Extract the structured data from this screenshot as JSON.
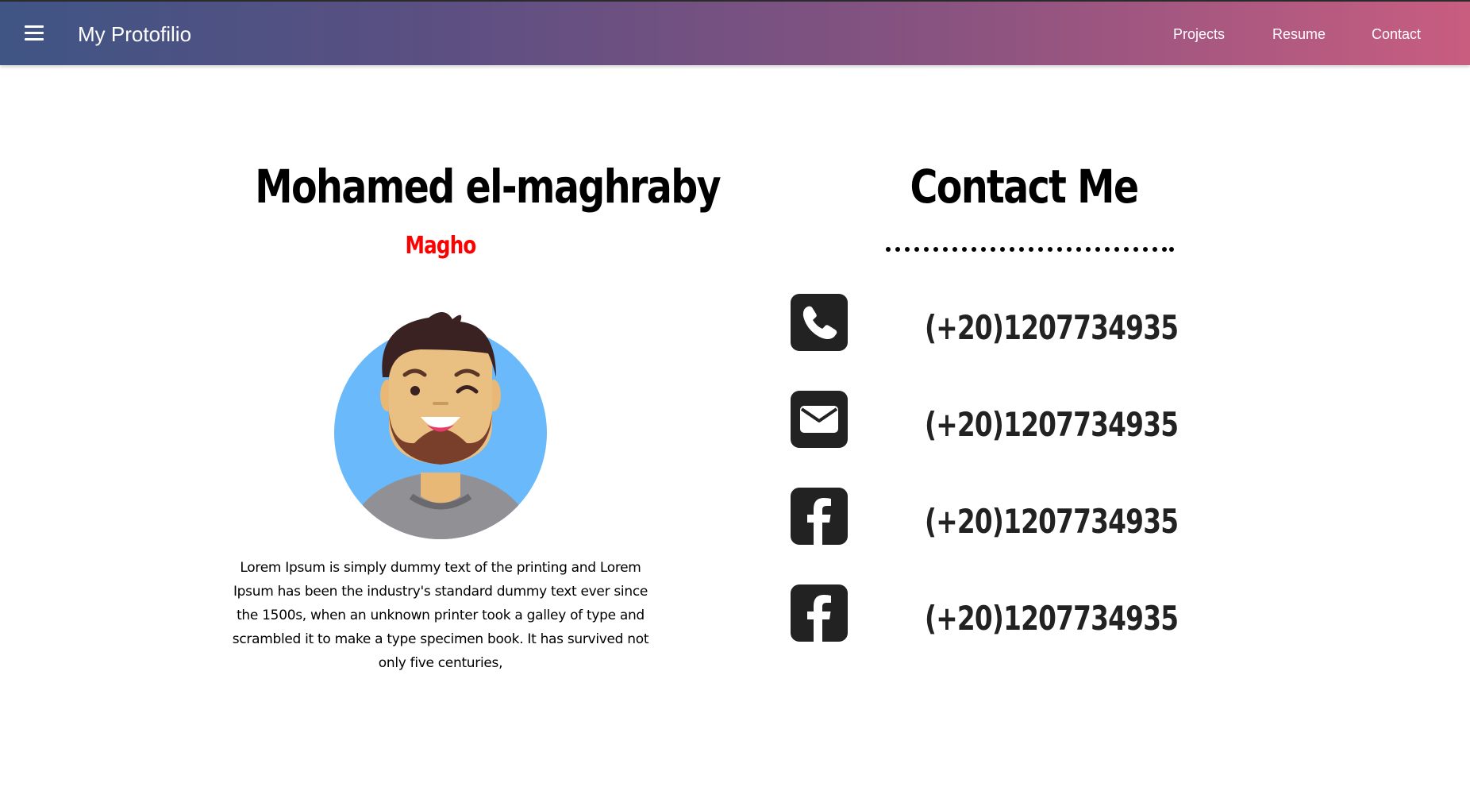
{
  "nav": {
    "brand": "My Protofilio",
    "menu_icon": "hamburger-menu-icon",
    "links": [
      "Projects",
      "Resume",
      "Contact"
    ]
  },
  "profile": {
    "name": "Mohamed el-maghraby",
    "nickname": "Magho",
    "nickname_color": "#ff0000",
    "bio": "Lorem Ipsum is simply dummy text of the printing and Lorem Ipsum has been the industry's standard dummy text ever since the 1500s, when an unknown printer took a galley of type and scrambled it to make a type specimen book. It has survived not only five centuries,"
  },
  "contact": {
    "title": "Contact Me",
    "items": [
      {
        "icon": "phone-icon",
        "value": "(+20)1207734935"
      },
      {
        "icon": "envelope-icon",
        "value": "(+20)1207734935"
      },
      {
        "icon": "facebook-icon",
        "value": "(+20)1207734935"
      },
      {
        "icon": "facebook-icon",
        "value": "(+20)1207734935"
      }
    ]
  },
  "colors": {
    "nav_gradient_start": "#3f5584",
    "nav_gradient_end": "#c85d80",
    "icon_bg": "#222222"
  }
}
